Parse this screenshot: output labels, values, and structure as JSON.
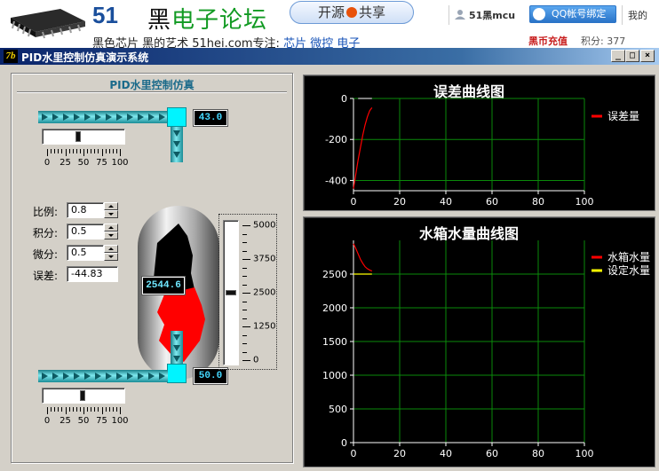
{
  "site": {
    "logo_51": "51",
    "logo_hei": "黑",
    "logo_rest": "电子论坛",
    "slogan_prefix": "黑色芯片 黑的艺术  51hei.com专注:",
    "slogan_links": "芯片  微控  电子",
    "open_share_left": "开源",
    "open_share_right": "共享",
    "user_name": "51黑mcu",
    "qq_bind": "QQ帐号绑定",
    "my": "我的",
    "recharge": "黑币充值",
    "credits": "积分: 377"
  },
  "window": {
    "icon_text": "7b",
    "title": "PID水里控制仿真演示系统",
    "min": "_",
    "max": "□",
    "close": "×"
  },
  "panel": {
    "title": "PID水里控制仿真",
    "inlet_value": "43.0",
    "outlet_value": "50.0",
    "tank_level": "2544.6",
    "inlet_slider_fraction": 0.43,
    "outlet_slider_fraction": 0.5,
    "level_slider_value": 2544.6,
    "level_max": 5000,
    "h_scale_labels": [
      "0",
      "25",
      "50",
      "75",
      "100"
    ],
    "v_scale_labels": [
      "5000",
      "3750",
      "2500",
      "1250",
      "0"
    ],
    "fields": [
      {
        "label": "比例:",
        "value": "0.8",
        "spin": true
      },
      {
        "label": "积分:",
        "value": "0.5",
        "spin": true
      },
      {
        "label": "微分:",
        "value": "0.5",
        "spin": true
      },
      {
        "label": "误差:",
        "value": "-44.83",
        "spin": false
      }
    ],
    "colors": {
      "pipe": "#3cc4cc",
      "valve": "#00f4ff",
      "water": "#ff0000",
      "air": "#000000"
    }
  },
  "chart_data": [
    {
      "type": "line",
      "title": "误差曲线图",
      "xlim": [
        0,
        100
      ],
      "ylim": [
        -450,
        0
      ],
      "xticks": [
        "0",
        "20",
        "40",
        "60",
        "80",
        "100"
      ],
      "yticks": [
        "0",
        "-200",
        "-400"
      ],
      "grid": true,
      "legend_position": "right",
      "series": [
        {
          "name": "误差量",
          "color": "#ff0000",
          "x": [
            0,
            1,
            2,
            3,
            4,
            5,
            6,
            7,
            8
          ],
          "y": [
            -440,
            -370,
            -300,
            -240,
            -180,
            -130,
            -90,
            -60,
            -45
          ]
        }
      ],
      "reference_lines": [
        {
          "color": "#ffffff",
          "x": [
            2,
            8
          ],
          "y": [
            0,
            0
          ]
        }
      ]
    },
    {
      "type": "line",
      "title": "水箱水量曲线图",
      "xlim": [
        0,
        100
      ],
      "ylim": [
        0,
        3000
      ],
      "xticks": [
        "0",
        "20",
        "40",
        "60",
        "80",
        "100"
      ],
      "yticks": [
        "2500",
        "2000",
        "1500",
        "1000",
        "500",
        "0"
      ],
      "grid": true,
      "legend_position": "right",
      "series": [
        {
          "name": "水箱水量",
          "color": "#ff0000",
          "x": [
            0,
            1,
            2,
            3,
            4,
            5,
            6,
            7,
            8
          ],
          "y": [
            2950,
            2880,
            2800,
            2720,
            2660,
            2610,
            2580,
            2560,
            2545
          ]
        },
        {
          "name": "设定水量",
          "color": "#ffff00",
          "x": [
            0,
            8
          ],
          "y": [
            2500,
            2500
          ]
        }
      ]
    }
  ]
}
